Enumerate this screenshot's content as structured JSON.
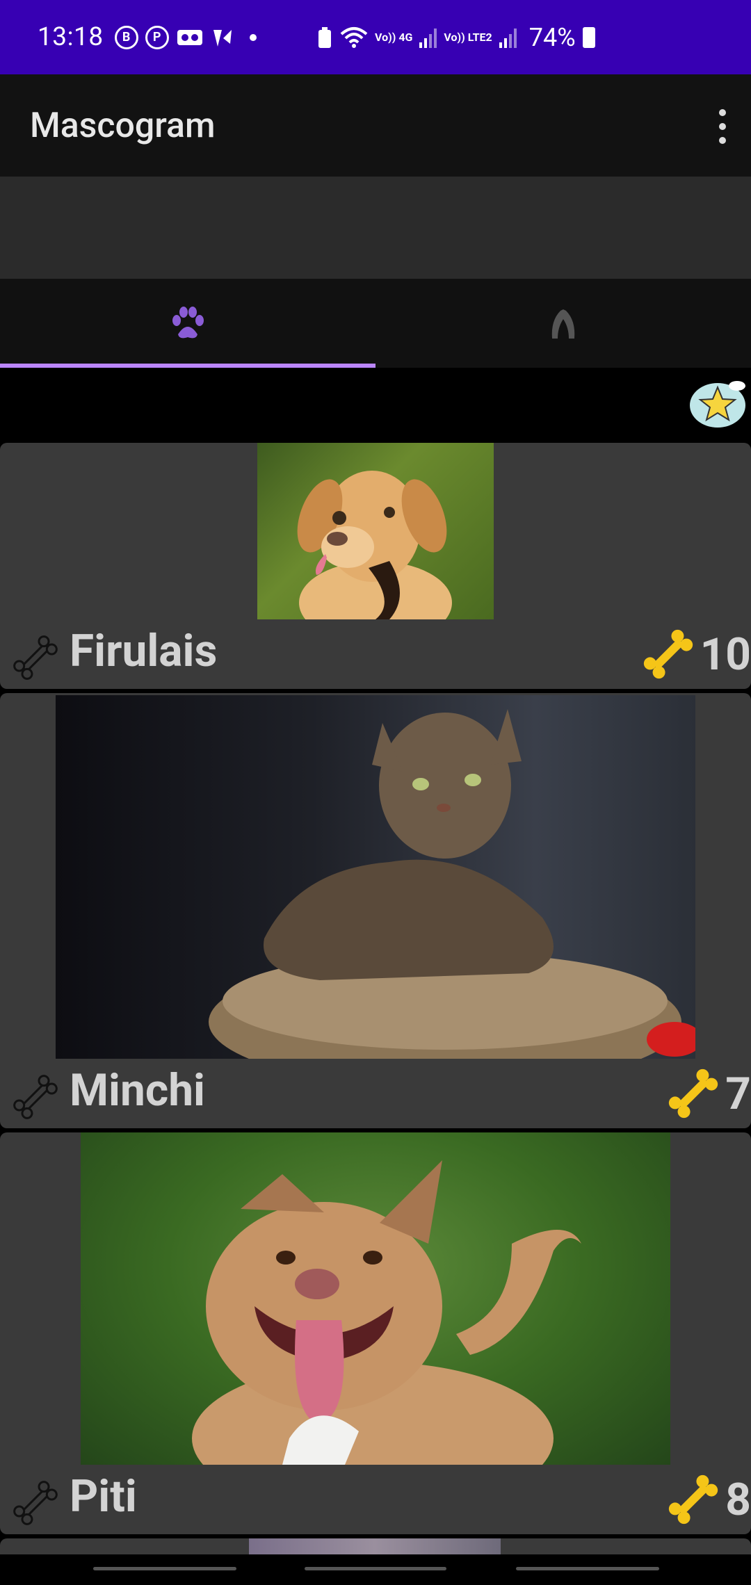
{
  "status_bar": {
    "time": "13:18",
    "battery_percent": "74%",
    "network_labels": [
      "Vo)) 4G",
      "Vo)) LTE2"
    ]
  },
  "app_bar": {
    "title": "Mascogram",
    "overflow_icon": "more-vert-icon"
  },
  "tabs": [
    {
      "icon": "paw-icon",
      "selected": true
    },
    {
      "icon": "paw-outline-icon",
      "selected": false
    }
  ],
  "favorites_icon": "star-cloud-icon",
  "pets": [
    {
      "name": "Firulais",
      "rating": "10",
      "photo": "golden-retriever-photo"
    },
    {
      "name": "Minchi",
      "rating": "7",
      "photo": "maine-coon-cat-photo"
    },
    {
      "name": "Piti",
      "rating": "8",
      "photo": "pitbull-dog-photo"
    }
  ],
  "colors": {
    "status_bar": "#3700b3",
    "accent": "#bb86fc",
    "card": "#3a3a3a",
    "bone_gold": "#f5c518"
  }
}
